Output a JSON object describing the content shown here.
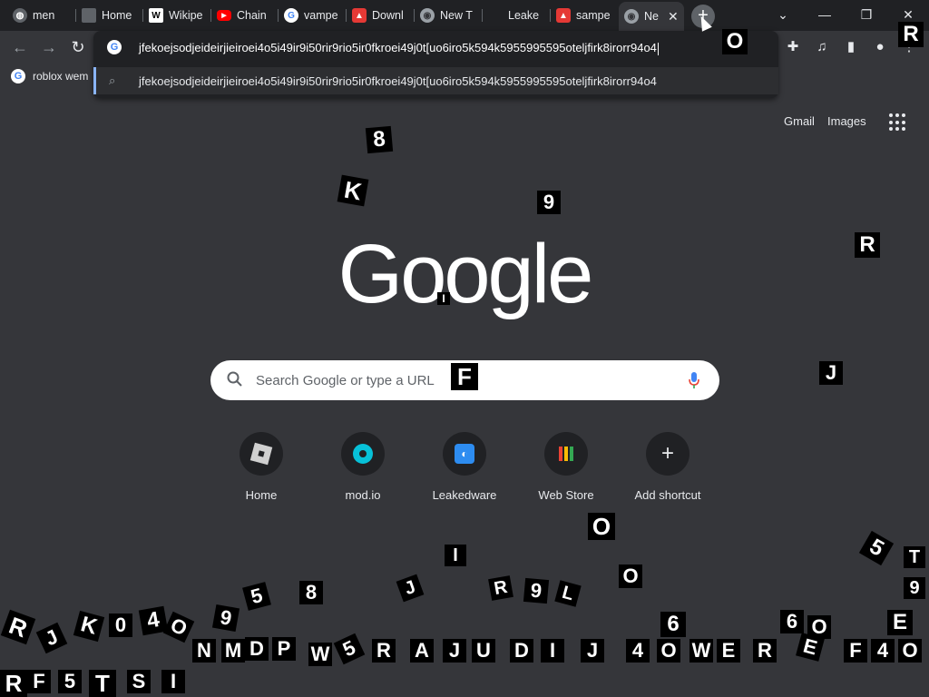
{
  "tabs": [
    {
      "label": "men",
      "icon": "globe-icon"
    },
    {
      "label": "Home",
      "icon": "roblox-icon"
    },
    {
      "label": "Wikipe",
      "icon": "wikipedia-icon"
    },
    {
      "label": "Chain",
      "icon": "youtube-icon"
    },
    {
      "label": "vampe",
      "icon": "google-icon"
    },
    {
      "label": "Downl",
      "icon": "leakedware-icon"
    },
    {
      "label": "New T",
      "icon": "chrome-icon"
    },
    {
      "label": "Leake",
      "icon": "leakedware-icon"
    },
    {
      "label": "sampe",
      "icon": "leakedware-icon"
    },
    {
      "label": "Ne",
      "icon": "chrome-icon",
      "active": true
    }
  ],
  "window_controls": {
    "dropdown": "⌄",
    "minimize": "—",
    "maximize": "❐",
    "close": "✕"
  },
  "omnibox": {
    "value": "jfekoejsodjeideirjieiroei4o5i49ir9i50rir9rio5ir0fkroei49j0t[uo6iro5k594k5955995595oteljfirk8irorr94o4",
    "suggestion": "jfekoejsodjeideirjieiroei4o5i49ir9i50rir9rio5ir0fkroei49j0t[uo6iro5k594k5955995595oteljfirk8irorr94o4"
  },
  "bookmark": {
    "label": "roblox wem"
  },
  "header_links": {
    "gmail": "Gmail",
    "images": "Images"
  },
  "logo_text": "Google",
  "search": {
    "placeholder": "Search Google or type a URL"
  },
  "shortcuts": [
    {
      "label": "Home",
      "icon": "roblox-icon"
    },
    {
      "label": "mod.io",
      "icon": "modio-icon"
    },
    {
      "label": "Leakedware",
      "icon": "leakedware-icon"
    },
    {
      "label": "Web Store",
      "icon": "webstore-icon"
    },
    {
      "label": "Add shortcut",
      "icon": "plus-icon"
    }
  ],
  "falling_letters": [
    "8",
    "K",
    "9",
    "R",
    "I",
    "F",
    "J",
    "O",
    "R",
    "O",
    "O",
    "5",
    "T",
    "9",
    "R",
    "9",
    "L",
    "J",
    "I",
    "8",
    "5",
    "9",
    "6",
    "6",
    "O",
    "E",
    "R",
    "J",
    "K",
    "0",
    "4",
    "O",
    "N",
    "M",
    "D",
    "P",
    "W",
    "5",
    "R",
    "A",
    "J",
    "U",
    "D",
    "I",
    "J",
    "4",
    "O",
    "W",
    "E",
    "R",
    "E",
    "F",
    "4",
    "O",
    "R",
    "F",
    "5",
    "T",
    "S",
    "I"
  ]
}
